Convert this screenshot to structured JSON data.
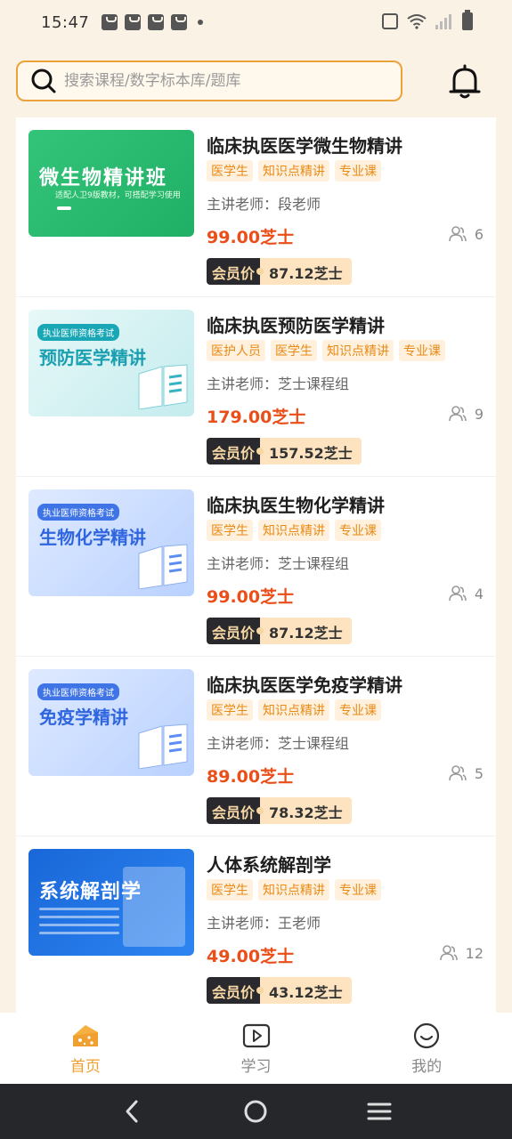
{
  "status_bar": {
    "time": "15:47"
  },
  "search": {
    "placeholder": "搜索课程/数字标本库/题库"
  },
  "thumbnails": {
    "t1_title": "微生物精讲班",
    "t1_sub": "适配人卫9版教材，可搭配学习使用",
    "t2_badge": "执业医师资格考试",
    "t2_title": "预防医学精讲",
    "t3_badge": "执业医师资格考试",
    "t3_title": "生物化学精讲",
    "t4_badge": "执业医师资格考试",
    "t4_title": "免疫学精讲",
    "t5_title": "系统解剖学"
  },
  "courses": [
    {
      "title": "临床执医医学微生物精讲",
      "tags": [
        "医学生",
        "知识点精讲",
        "专业课"
      ],
      "teacher": "主讲老师：段老师",
      "price": "99.00芝士",
      "learners": "6",
      "member_label": "会员价",
      "member_price": "87.12芝士"
    },
    {
      "title": "临床执医预防医学精讲",
      "tags": [
        "医护人员",
        "医学生",
        "知识点精讲",
        "专业课"
      ],
      "teacher": "主讲老师：芝士课程组",
      "price": "179.00芝士",
      "learners": "9",
      "member_label": "会员价",
      "member_price": "157.52芝士"
    },
    {
      "title": "临床执医生物化学精讲",
      "tags": [
        "医学生",
        "知识点精讲",
        "专业课"
      ],
      "teacher": "主讲老师：芝士课程组",
      "price": "99.00芝士",
      "learners": "4",
      "member_label": "会员价",
      "member_price": "87.12芝士"
    },
    {
      "title": "临床执医医学免疫学精讲",
      "tags": [
        "医学生",
        "知识点精讲",
        "专业课"
      ],
      "teacher": "主讲老师：芝士课程组",
      "price": "89.00芝士",
      "learners": "5",
      "member_label": "会员价",
      "member_price": "78.32芝士"
    },
    {
      "title": "人体系统解剖学",
      "tags": [
        "医学生",
        "知识点精讲",
        "专业课"
      ],
      "teacher": "主讲老师：王老师",
      "price": "49.00芝士",
      "learners": "12",
      "member_label": "会员价",
      "member_price": "43.12芝士"
    }
  ],
  "bottom_nav": [
    {
      "label": "首页",
      "icon": "cheese-home-icon",
      "active": true
    },
    {
      "label": "学习",
      "icon": "play-icon",
      "active": false
    },
    {
      "label": "我的",
      "icon": "smiley-icon",
      "active": false
    }
  ],
  "colors": {
    "accent": "#f0a030",
    "price": "#ea4e19",
    "tag_bg": "#fff1dd"
  }
}
